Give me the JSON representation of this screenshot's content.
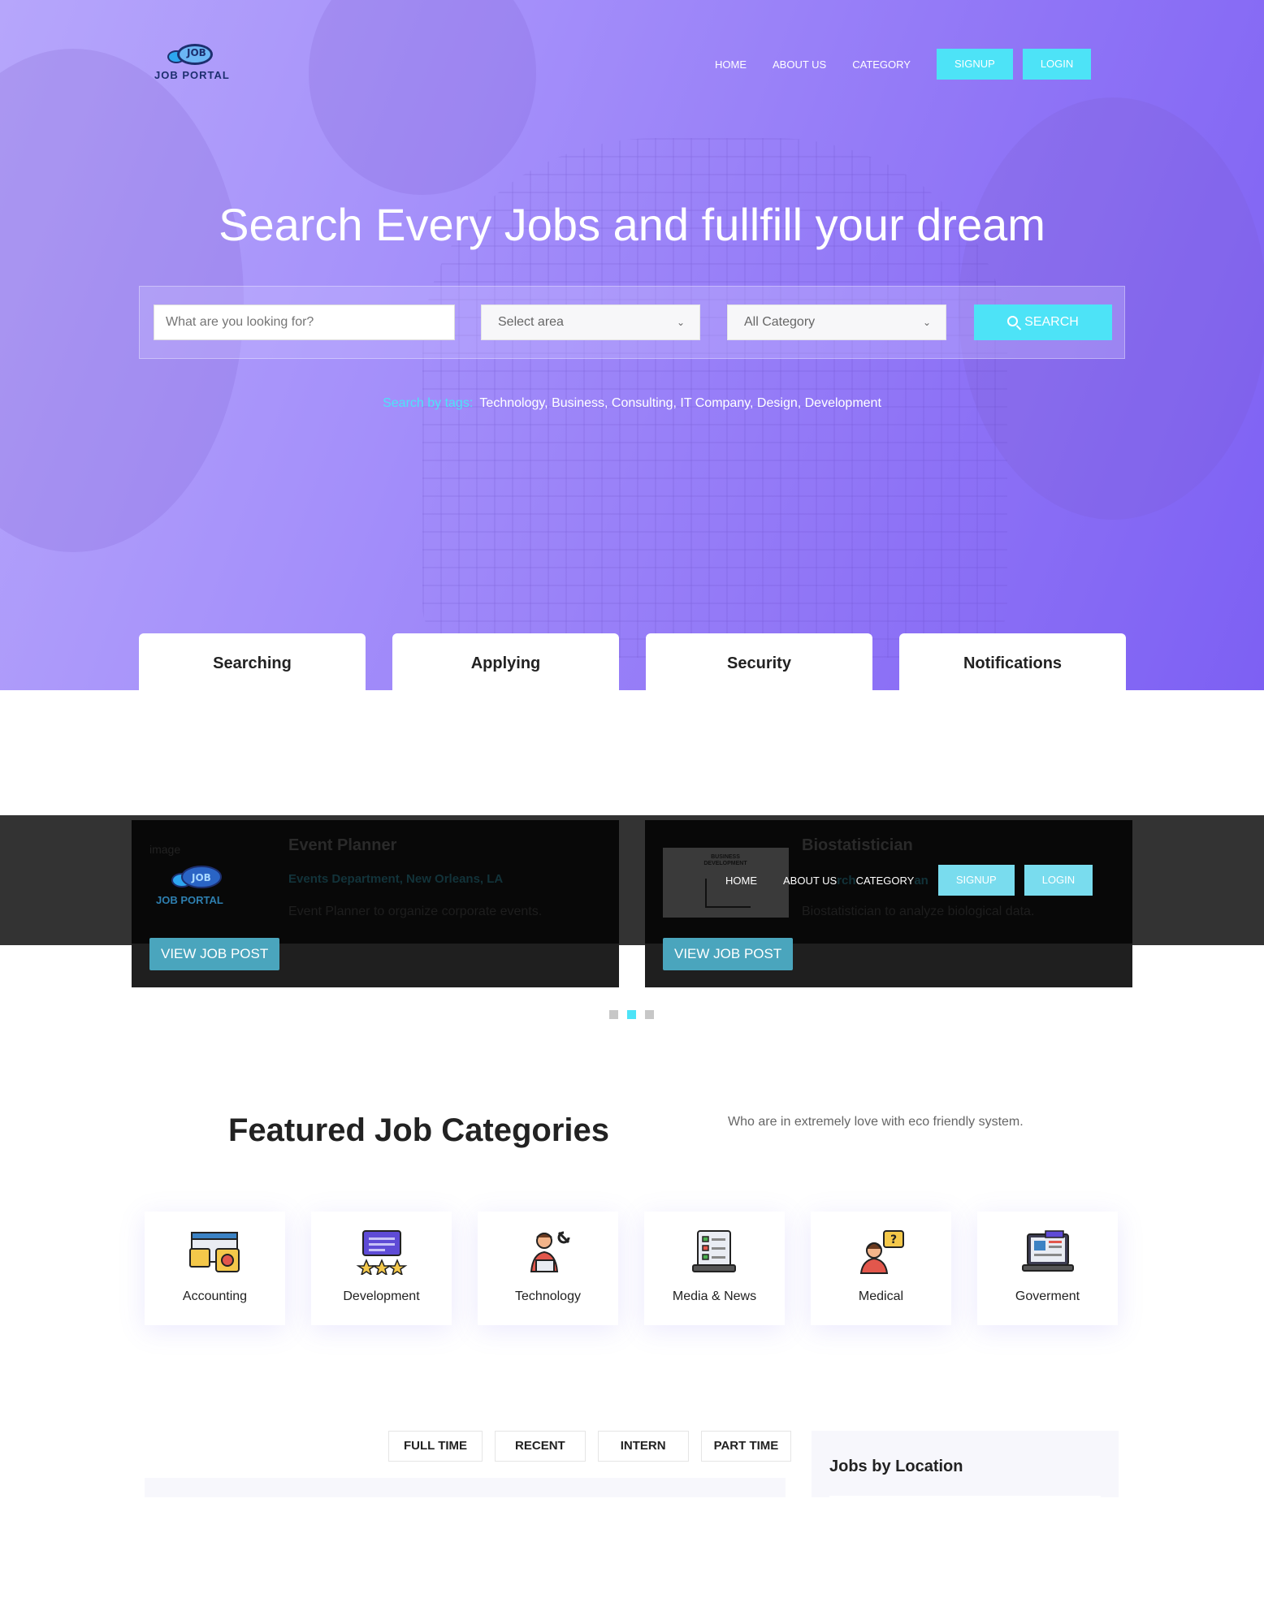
{
  "brand": {
    "logo_bubble": "JOB",
    "logo_text": "JOB PORTAL"
  },
  "nav": {
    "items": [
      "HOME",
      "ABOUT US",
      "CATEGORY"
    ],
    "signup": "SIGNUP",
    "login": "LOGIN"
  },
  "hero": {
    "title": "Search Every Jobs and fullfill your dream",
    "search_placeholder": "What are you looking for?",
    "area_select": "Select area",
    "category_select": "All Category",
    "search_button": "SEARCH",
    "tags_label": "Search by tags:",
    "tags": "Technology, Business, Consulting, IT Company, Design, Development"
  },
  "feature_tabs": [
    "Searching",
    "Applying",
    "Security",
    "Notifications"
  ],
  "jobs": [
    {
      "image_alt": "image",
      "title": "Event Planner",
      "department": "Events Department, New Orleans, LA",
      "description": "Event Planner to organize corporate events.",
      "button": "VIEW JOB POST"
    },
    {
      "image_label": "BUSINESS DEVELOPMENT",
      "title": "Biostatistician",
      "department": "Research Department",
      "department_visible": "rch",
      "department_tail": "an",
      "description": "Biostatistician to analyze biological data.",
      "button": "VIEW JOB POST"
    }
  ],
  "carousel": {
    "count": 3,
    "active_index": 1
  },
  "featured": {
    "title": "Featured Job Categories",
    "subtitle": "Who are in extremely love with eco friendly system.",
    "categories": [
      {
        "label": "Accounting",
        "icon": "accounting-icon"
      },
      {
        "label": "Development",
        "icon": "development-icon"
      },
      {
        "label": "Technology",
        "icon": "technology-icon"
      },
      {
        "label": "Media & News",
        "icon": "media-news-icon"
      },
      {
        "label": "Medical",
        "icon": "medical-icon"
      },
      {
        "label": "Goverment",
        "icon": "government-icon"
      }
    ]
  },
  "listing": {
    "filters": [
      "FULL TIME",
      "RECENT",
      "INTERN",
      "PART TIME"
    ],
    "location_heading": "Jobs by Location"
  },
  "colors": {
    "accent": "#4de3f7",
    "hero_start": "#b6a6fb",
    "hero_end": "#7d60f3",
    "view_button": "#4aa5bd",
    "dark_band": "#333333"
  }
}
